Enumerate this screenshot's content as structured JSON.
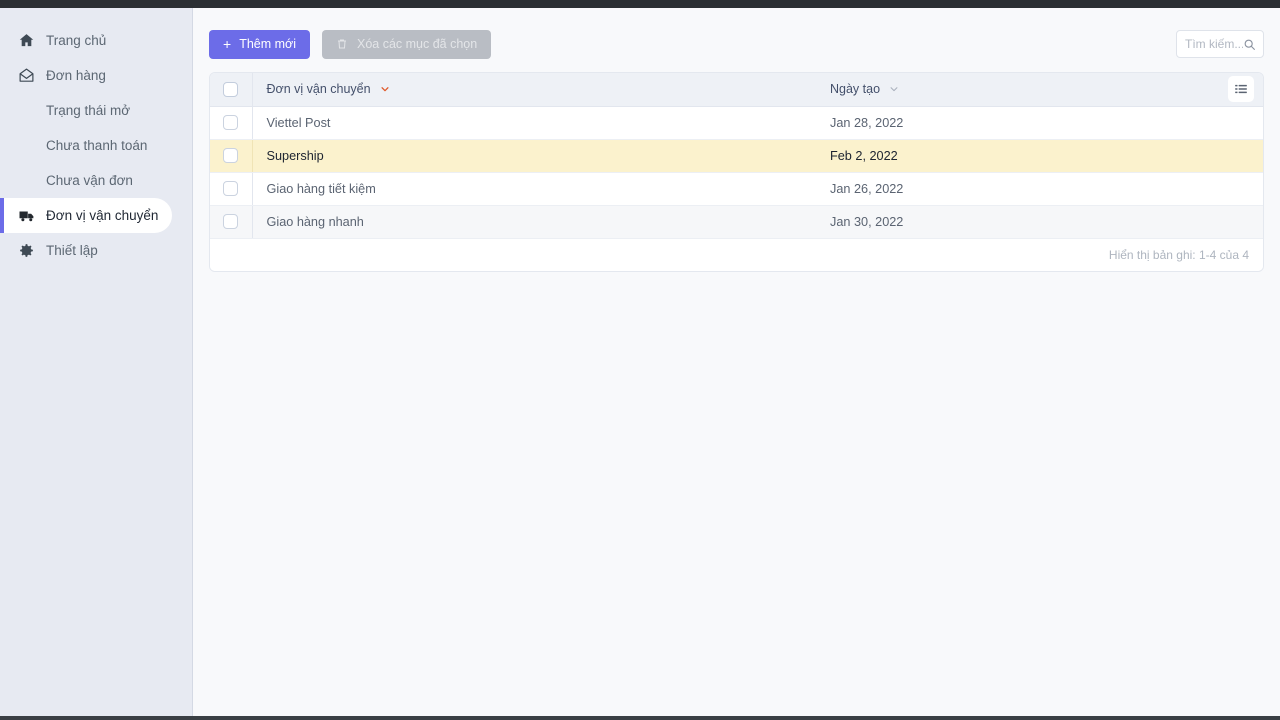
{
  "sidebar": {
    "items": [
      {
        "label": "Trang chủ",
        "icon": "home-icon",
        "active": false,
        "sub": false
      },
      {
        "label": "Đơn hàng",
        "icon": "mail-icon",
        "active": false,
        "sub": false
      },
      {
        "label": "Trạng thái mở",
        "icon": "",
        "active": false,
        "sub": true
      },
      {
        "label": "Chưa thanh toán",
        "icon": "",
        "active": false,
        "sub": true
      },
      {
        "label": "Chưa vận đơn",
        "icon": "",
        "active": false,
        "sub": true
      },
      {
        "label": "Đơn vị vận chuyển",
        "icon": "truck-icon",
        "active": true,
        "sub": false
      },
      {
        "label": "Thiết lập",
        "icon": "gear-icon",
        "active": false,
        "sub": false
      }
    ],
    "accent_color": "#6c6ce8",
    "background_color": "#e7eaf2"
  },
  "toolbar": {
    "add_label": "Thêm mới",
    "add_icon": "plus-icon",
    "delete_label": "Xóa các mục đã chọn",
    "delete_icon": "trash-icon",
    "delete_disabled": true,
    "primary_color": "#6c6ce8"
  },
  "search": {
    "placeholder": "Tìm kiếm...",
    "value": "",
    "icon": "search-icon"
  },
  "table": {
    "columns": [
      {
        "label": "Đơn vị vận chuyển",
        "sort_icon": "chevron-down-icon",
        "sort_color": "#e05a2b"
      },
      {
        "label": "Ngày tạo",
        "sort_icon": "chevron-down-icon",
        "sort_color": "#aab1bd"
      }
    ],
    "menu_icon": "list-icon",
    "rows": [
      {
        "name": "Viettel Post",
        "date": "Jan 28, 2022",
        "highlight": false
      },
      {
        "name": "Supership",
        "date": "Feb 2, 2022",
        "highlight": true
      },
      {
        "name": "Giao hàng tiết kiệm",
        "date": "Jan 26, 2022",
        "highlight": false
      },
      {
        "name": "Giao hàng nhanh",
        "date": "Jan 30, 2022",
        "highlight": false
      }
    ],
    "footer_text": "Hiển thị bản ghi: 1-4 của 4",
    "highlight_color": "#fbf2cd"
  }
}
